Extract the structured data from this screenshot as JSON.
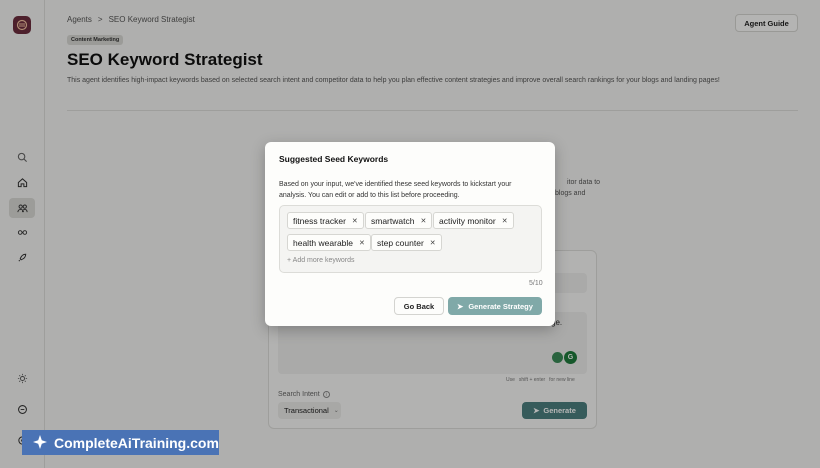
{
  "sidebar": {
    "logo_color": "#6b2d3d",
    "icons": [
      {
        "name": "search-icon",
        "active": false
      },
      {
        "name": "home-icon",
        "active": false
      },
      {
        "name": "agents-icon",
        "active": true
      },
      {
        "name": "team-icon",
        "active": false
      },
      {
        "name": "rocket-icon",
        "active": false
      },
      {
        "name": "theme-icon",
        "active": false
      },
      {
        "name": "chat-icon",
        "active": false
      },
      {
        "name": "settings-icon",
        "active": false
      }
    ]
  },
  "breadcrumb": {
    "root": "Agents",
    "separator": ">",
    "current": "SEO Keyword Strategist"
  },
  "header": {
    "agent_guide_label": "Agent Guide",
    "tag": "Content Marketing",
    "title": "SEO Keyword Strategist",
    "description": "This agent identifies high-impact keywords based on selected search intent and competitor data to help you plan effective content strategies and improve overall search rankings for your blogs and landing pages!"
  },
  "background": {
    "partial_text_1": "itor data to",
    "partial_text_2": "blogs and",
    "partial_textarea": "ge.",
    "hint_use": "Use",
    "hint_keys": "shift + enter",
    "hint_newline": "for new line",
    "search_intent_label": "Search Intent",
    "search_intent_value": "Transactional",
    "generate_label": "Generate"
  },
  "modal": {
    "title": "Suggested Seed Keywords",
    "description": "Based on your input, we've identified these seed keywords to kickstart your analysis. You can edit or add to this list before proceeding.",
    "keywords": [
      "fitness tracker",
      "smartwatch",
      "activity monitor",
      "health wearable",
      "step counter"
    ],
    "add_placeholder": "+ Add more keywords",
    "count": "5/10",
    "go_back_label": "Go Back",
    "generate_strategy_label": "Generate Strategy"
  },
  "watermark": {
    "text": "CompleteAiTraining.com"
  },
  "colors": {
    "accent": "#2e6b6b",
    "accent_disabled": "#80a9a8",
    "watermark_bg": "#4a73b5"
  }
}
